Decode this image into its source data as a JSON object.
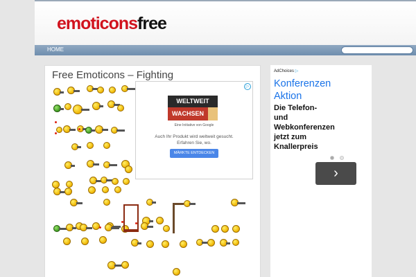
{
  "header": {
    "logo_part1": "emoticons",
    "logo_part2": "free"
  },
  "nav": {
    "home_label": "HOME",
    "search_placeholder": ""
  },
  "post": {
    "title": "Free Emoticons – Fighting"
  },
  "ad": {
    "brand_top": "WELTWEIT",
    "brand_bottom": "WACHSEN",
    "initiative": "Eine Initiative von Google",
    "text": "Auch Ihr Produkt wird weltweit gesucht. Erfahren Sie, wo.",
    "button": "MÄRKTE ENTDECKEN"
  },
  "sidebar_ad": {
    "adchoices": "AdChoices",
    "headline": "Konferenzen Aktion",
    "body": "Die Telefon- und Webkonferenzen jetzt zum Knallerpreis",
    "next": "›"
  },
  "colors": {
    "nav": "#7f9cba",
    "logo_red": "#d1131e",
    "headline_blue": "#1a73e8"
  }
}
